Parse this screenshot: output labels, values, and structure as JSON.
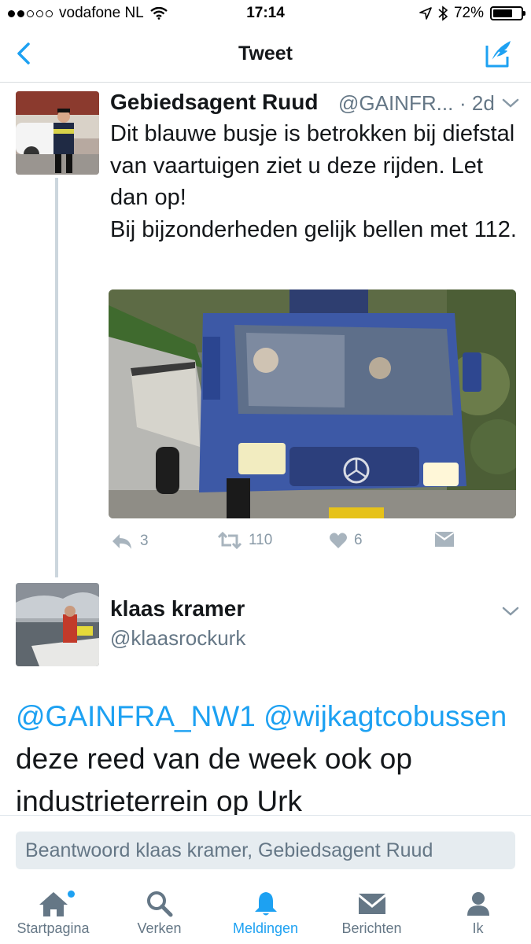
{
  "status_bar": {
    "carrier": "vodafone NL",
    "time": "17:14",
    "battery_pct": "72%",
    "battery_level": 0.72,
    "signal_bars": 2
  },
  "nav": {
    "title": "Tweet",
    "back_icon": "chevron-left-icon",
    "compose_icon": "compose-quill-icon"
  },
  "tweet": {
    "author_name": "Gebiedsagent Ruud",
    "author_handle": "@GAINFR...",
    "time_ago": "· 2d",
    "text": "Dit blauwe busje is betrokken bij diefstal van vaartuigen ziet u deze rijden. Let dan op!\nBij bijzonderheden gelijk bellen met 112.",
    "image_plate": "",
    "actions": {
      "reply_count": "3",
      "retweet_count": "110",
      "like_count": "6"
    }
  },
  "reply": {
    "author_name": "klaas kramer",
    "author_handle": "@klaasrockurk",
    "mention1": "@GAINFRA_NW1",
    "mention2": "@wijkagtcobussen",
    "text": "deze reed van de week ook op industrieterrein op Urk"
  },
  "reply_box": {
    "placeholder": "Beantwoord klaas kramer, Gebiedsagent Ruud"
  },
  "tabs": [
    {
      "label": "Startpagina",
      "icon": "home-icon",
      "active": false
    },
    {
      "label": "Verken",
      "icon": "search-icon",
      "active": false
    },
    {
      "label": "Meldingen",
      "icon": "bell-icon",
      "active": true
    },
    {
      "label": "Berichten",
      "icon": "envelope-icon",
      "active": false
    },
    {
      "label": "Ik",
      "icon": "person-icon",
      "active": false
    }
  ],
  "colors": {
    "accent": "#1da1f2",
    "muted": "#8899a6",
    "text": "#14171a"
  }
}
